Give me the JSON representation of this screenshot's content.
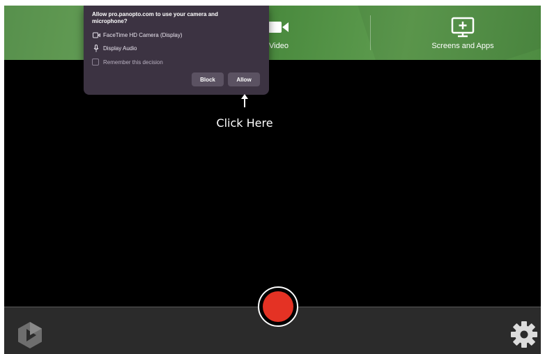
{
  "toolbar": {
    "video_label": "Video",
    "screens_label": "Screens and Apps"
  },
  "permission_popup": {
    "title": "Allow pro.panopto.com to use your camera and microphone?",
    "camera_label": "FaceTime HD Camera (Display)",
    "audio_label": "Display Audio",
    "remember_label": "Remember this decision",
    "remember_checked": false,
    "block_label": "Block",
    "allow_label": "Allow"
  },
  "annotation": {
    "text": "Click Here"
  },
  "icons": {
    "video": "video-camera-icon",
    "screens": "screen-add-icon",
    "camera": "camera-icon",
    "microphone": "microphone-icon",
    "logo": "panopto-logo-icon",
    "settings": "gear-icon"
  },
  "colors": {
    "toolbar_green": "#5a9a4c",
    "popup_bg": "#3c3342",
    "record_red": "#e43224",
    "bottom_bar": "#2b2b2b"
  }
}
